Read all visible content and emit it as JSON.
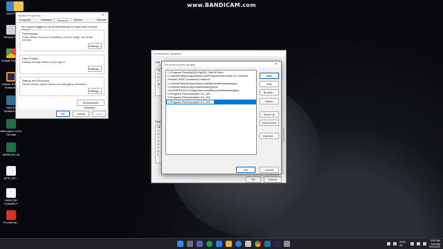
{
  "watermark": "www.BANDICAM.com",
  "desktop_icons": [
    {
      "label": "This PC",
      "icon": "computer-icon"
    },
    {
      "label": "Recycle Bin",
      "icon": "recycle-bin-icon"
    },
    {
      "label": "Google Chrome",
      "icon": "chrome-icon"
    },
    {
      "label": "Eclipse IDE for Enterprise",
      "icon": "eclipse-icon"
    },
    {
      "label": "MySQL Workbench",
      "icon": "mysql-icon"
    },
    {
      "label": "Attendance Jul'21 Till Date",
      "icon": "excel-icon"
    },
    {
      "label": "WEBD201-20",
      "icon": "excel-icon"
    },
    {
      "label": "MPR_INT...",
      "icon": "file-icon"
    },
    {
      "label": "MENTOR CONNECT",
      "icon": "file-icon"
    },
    {
      "label": "Provisional...",
      "icon": "pdf-icon"
    }
  ],
  "system_properties": {
    "title": "System Properties",
    "tabs": [
      "Computer Name",
      "Hardware",
      "Advanced",
      "System Protection",
      "Remote"
    ],
    "active_tab": "Advanced",
    "admin_note": "You must be logged on as an Administrator to make most of these changes.",
    "performance": {
      "title": "Performance",
      "desc": "Visual effects, processor scheduling, memory usage, and virtual memory",
      "button": "Settings..."
    },
    "user_profiles": {
      "title": "User Profiles",
      "desc": "Desktop settings related to your sign-in",
      "button": "Settings..."
    },
    "startup_recovery": {
      "title": "Startup and Recovery",
      "desc": "System startup, system failure, and debugging information",
      "button": "Settings..."
    },
    "env_button": "Environment Variables...",
    "ok": "OK",
    "cancel": "Cancel",
    "apply": "Apply"
  },
  "environment_variables": {
    "title": "Environment Variables",
    "user_section": "Use",
    "system_section": "Syst",
    "user_rows": [
      "Va",
      "O",
      "O",
      "P",
      "Te",
      "T"
    ],
    "system_rows": [
      "Va",
      "C",
      "D",
      "J",
      "N",
      "O",
      "P",
      "R",
      "S"
    ],
    "ok": "OK",
    "cancel": "Cancel"
  },
  "edit_env": {
    "title": "Edit environment variable",
    "paths": [
      "C:\\Program Files\\MySQL\\MySQL Shell 8.0\\bin\\",
      "C:\\Users\\Pratyush\\AppData\\Local\\Programs\\Microsoft VS Code\\bin",
      "%IntelliJ IDEA Community Edition%",
      "C:\\Users\\Pratyush\\AppData\\Local\\Microsoft\\WindowsApps",
      "C:\\Users\\Pratyush\\AppData\\Roaming\\npm",
      "%USERPROFILE%\\AppData\\Local\\Microsoft\\WindowsApps",
      "C:\\Program Files\\Java\\jdk1.8.0_301",
      "C:\\Program Files\\Java\\jdk1.8.0_301",
      "C:\\Program Files\\Java\\jdk1.8.0_301"
    ],
    "buttons": {
      "new": "New",
      "edit": "Edit",
      "browse": "Browse...",
      "delete": "Delete",
      "move_up": "Move Up",
      "move_down": "Move Down",
      "edit_text": "Edit text..."
    },
    "ok": "OK",
    "cancel": "Cancel"
  },
  "taskbar": {
    "tray_lang": "ENG IN",
    "time": "2:02 AM",
    "day": "Sunday",
    "date": "8/1/2021"
  }
}
